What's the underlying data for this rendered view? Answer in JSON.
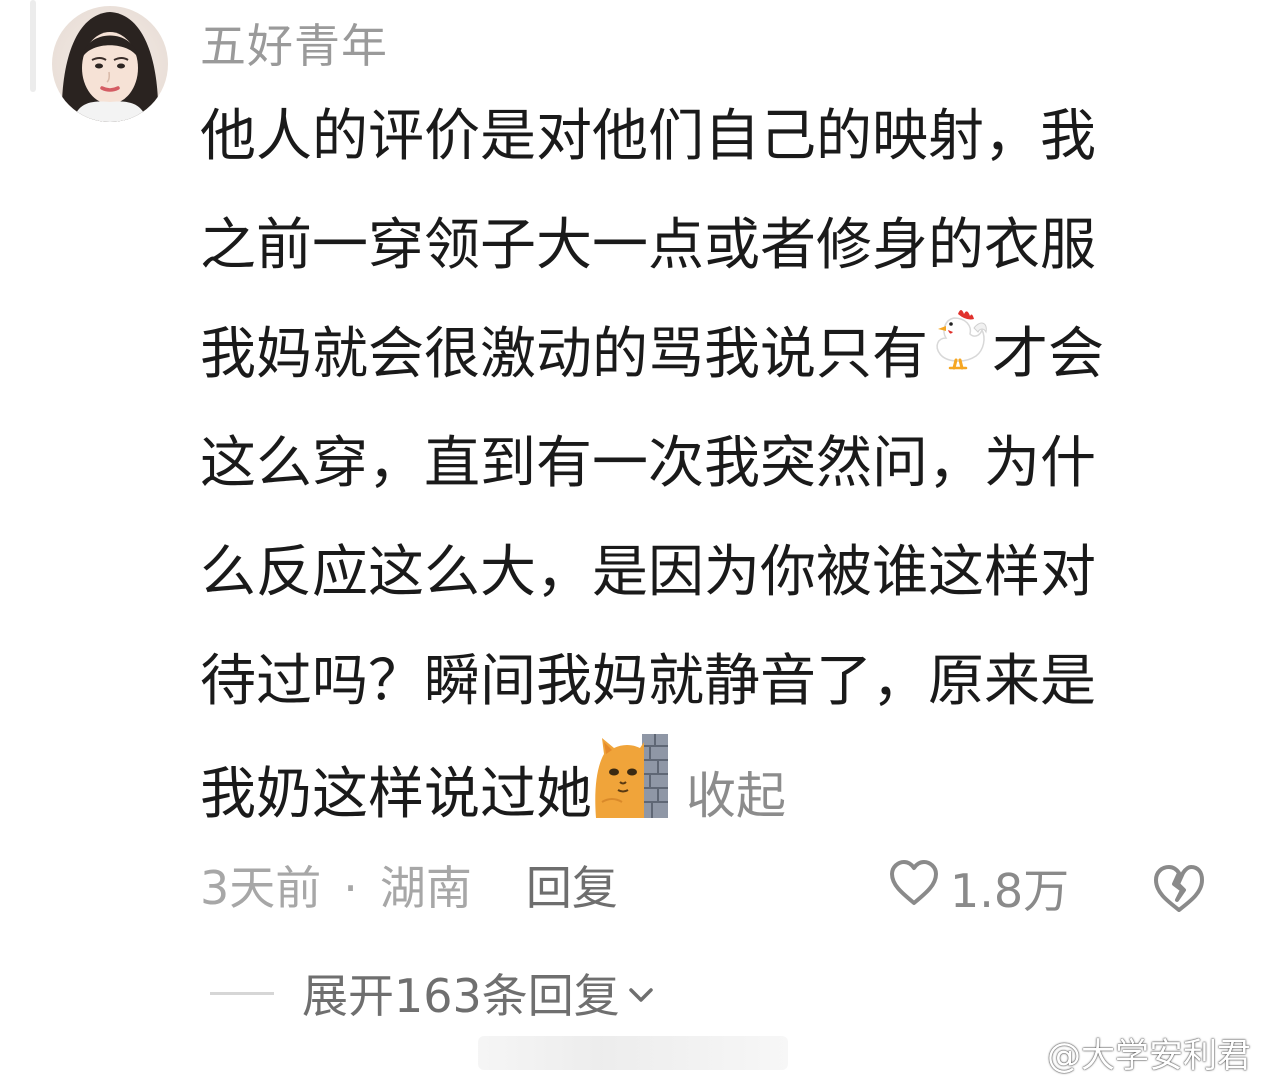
{
  "comment": {
    "username": "五好青年",
    "lines": [
      "他人的评价是对他们自己的映射，我",
      "之前一穿领子大一点或者修身的衣服",
      "我妈就会很激动的骂我说只有",
      "才会",
      "这么穿，直到有一次我突然问，为什",
      "么反应这么大，是因为你被谁这样对",
      "待过吗？瞬间我妈就静音了，原来是",
      "我奶这样说过她"
    ],
    "collapse_label": "收起",
    "emojis": {
      "line3": "chicken-emoji",
      "line8": "cat-behind-wall-emoji"
    }
  },
  "meta": {
    "time": "3天前",
    "separator": "·",
    "location": "湖南",
    "reply_label": "回复",
    "like_count": "1.8万"
  },
  "expand": {
    "label": "展开163条回复"
  },
  "watermark": {
    "text": "@大学安利君"
  },
  "icons": {
    "like": "heart-outline-icon",
    "dislike": "broken-heart-icon",
    "expand": "chevron-down-icon",
    "watermark": "weibo-logo-icon"
  },
  "colors": {
    "text_primary": "#1a1a1a",
    "text_secondary": "#9a9a9a",
    "background": "#ffffff"
  }
}
